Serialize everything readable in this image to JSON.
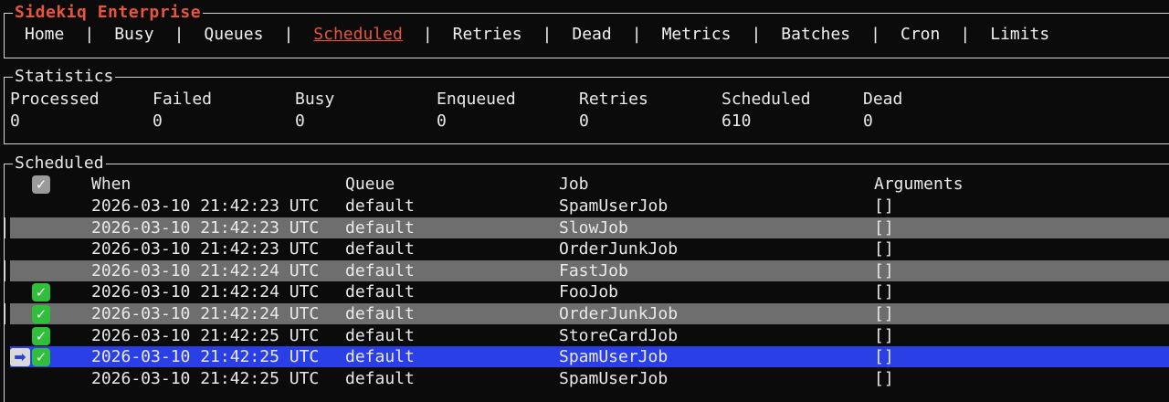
{
  "app": {
    "title": "Sidekiq Enterprise"
  },
  "nav": {
    "items": [
      "Home",
      "Busy",
      "Queues",
      "Scheduled",
      "Retries",
      "Dead",
      "Metrics",
      "Batches",
      "Cron",
      "Limits"
    ],
    "active": "Scheduled",
    "separator": "|"
  },
  "statistics": {
    "title": "Statistics",
    "items": [
      {
        "label": "Processed",
        "value": "0"
      },
      {
        "label": "Failed",
        "value": "0"
      },
      {
        "label": "Busy",
        "value": "0"
      },
      {
        "label": "Enqueued",
        "value": "0"
      },
      {
        "label": "Retries",
        "value": "0"
      },
      {
        "label": "Scheduled",
        "value": "610"
      },
      {
        "label": "Dead",
        "value": "0"
      }
    ]
  },
  "scheduled": {
    "title": "Scheduled",
    "columns": {
      "when": "When",
      "queue": "Queue",
      "job": "Job",
      "arguments": "Arguments"
    },
    "header_check_icon": "checkbox-checked-icon",
    "rows": [
      {
        "when": "2026-03-10 21:42:23 UTC",
        "queue": "default",
        "job": "SpamUserJob",
        "args": "[]",
        "checked": false,
        "selected": false
      },
      {
        "when": "2026-03-10 21:42:23 UTC",
        "queue": "default",
        "job": "SlowJob",
        "args": "[]",
        "checked": false,
        "selected": false
      },
      {
        "when": "2026-03-10 21:42:23 UTC",
        "queue": "default",
        "job": "OrderJunkJob",
        "args": "[]",
        "checked": false,
        "selected": false
      },
      {
        "when": "2026-03-10 21:42:24 UTC",
        "queue": "default",
        "job": "FastJob",
        "args": "[]",
        "checked": false,
        "selected": false
      },
      {
        "when": "2026-03-10 21:42:24 UTC",
        "queue": "default",
        "job": "FooJob",
        "args": "[]",
        "checked": true,
        "selected": false
      },
      {
        "when": "2026-03-10 21:42:24 UTC",
        "queue": "default",
        "job": "OrderJunkJob",
        "args": "[]",
        "checked": true,
        "selected": false
      },
      {
        "when": "2026-03-10 21:42:25 UTC",
        "queue": "default",
        "job": "StoreCardJob",
        "args": "[]",
        "checked": true,
        "selected": false
      },
      {
        "when": "2026-03-10 21:42:25 UTC",
        "queue": "default",
        "job": "SpamUserJob",
        "args": "[]",
        "checked": true,
        "selected": true
      },
      {
        "when": "2026-03-10 21:42:25 UTC",
        "queue": "default",
        "job": "SpamUserJob",
        "args": "[]",
        "checked": false,
        "selected": false
      }
    ]
  },
  "colors": {
    "brand": "#e8553a",
    "alt_row": "#6e6e6e",
    "selected_row": "#2a40e6",
    "check": "#2fbf3a"
  }
}
